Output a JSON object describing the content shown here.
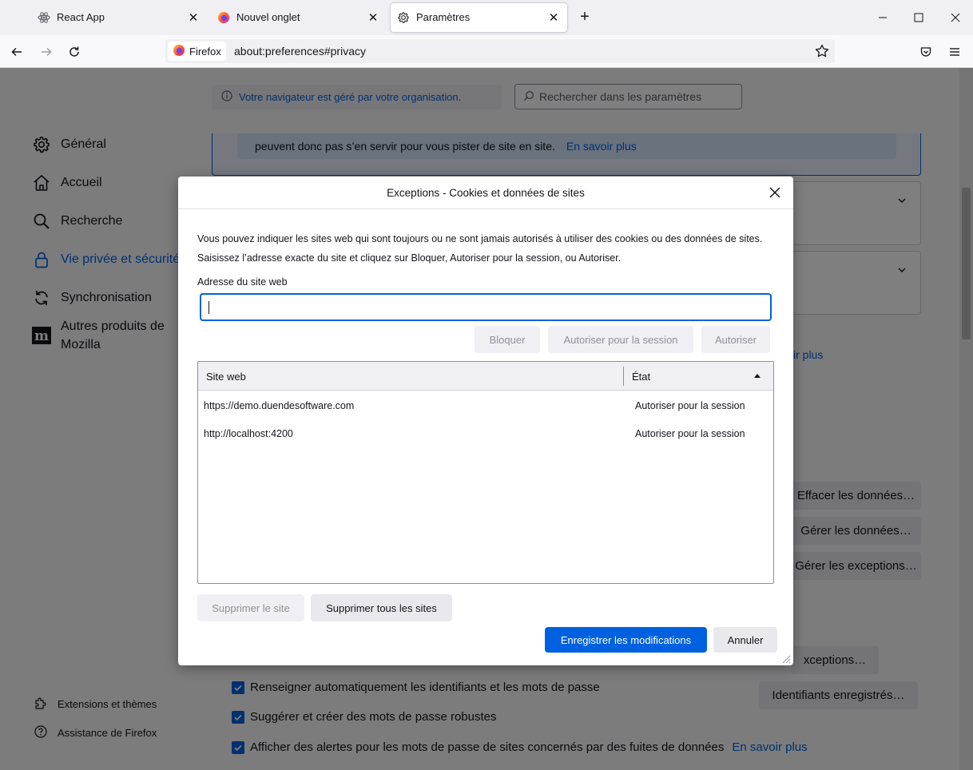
{
  "tabs": [
    {
      "label": "React App",
      "icon": "react-icon"
    },
    {
      "label": "Nouvel onglet",
      "icon": "firefox-icon"
    },
    {
      "label": "Paramètres",
      "icon": "gear-icon"
    }
  ],
  "navbar": {
    "identity_label": "Firefox",
    "url": "about:preferences#privacy"
  },
  "page": {
    "managed_notice": "Votre navigateur est géré par votre organisation.",
    "search_placeholder": "Rechercher dans les paramètres",
    "categories": [
      {
        "label": "Général",
        "icon": "gear-icon"
      },
      {
        "label": "Accueil",
        "icon": "home-icon"
      },
      {
        "label": "Recherche",
        "icon": "search-icon"
      },
      {
        "label": "Vie privée et sécurité",
        "icon": "lock-icon"
      },
      {
        "label": "Synchronisation",
        "icon": "sync-icon"
      },
      {
        "label": "Autres produits de Mozilla",
        "icon": "mozilla-icon"
      }
    ],
    "footer_links": [
      {
        "label": "Extensions et thèmes",
        "icon": "puzzle-icon"
      },
      {
        "label": "Assistance de Firefox",
        "icon": "help-icon"
      }
    ],
    "tracking_text": "peuvent donc pas s’en servir pour vous pister de site en site.",
    "learn_more": "En savoir plus",
    "partial_learn_more": "ir plus",
    "buttons": {
      "clear_data": "Effacer les données…",
      "manage_data": "Gérer les données…",
      "manage_exceptions": "Gérer les exceptions…",
      "exceptions": "xceptions…",
      "saved_logins": "Identifiants enregistrés…"
    },
    "checkboxes": [
      {
        "label": "Renseigner automatiquement les identifiants et les mots de passe",
        "link": ""
      },
      {
        "label": "Suggérer et créer des mots de passe robustes",
        "link": ""
      },
      {
        "label": "Afficher des alertes pour les mots de passe de sites concernés par des fuites de données",
        "link": "En savoir plus"
      }
    ]
  },
  "dialog": {
    "title": "Exceptions - Cookies et données de sites",
    "description": "Vous pouvez indiquer les sites web qui sont toujours ou ne sont jamais autorisés à utiliser des cookies ou des données de sites. Saisissez l’adresse exacte du site et cliquez sur Bloquer, Autoriser pour la session, ou Autoriser.",
    "address_label": "Adresse du site web",
    "address_value": "",
    "btn_block": "Bloquer",
    "btn_allow_session": "Autoriser pour la session",
    "btn_allow": "Autoriser",
    "col_site": "Site web",
    "col_status": "État",
    "rows": [
      {
        "site": "https://demo.duendesoftware.com",
        "status": "Autoriser pour la session"
      },
      {
        "site": "http://localhost:4200",
        "status": "Autoriser pour la session"
      }
    ],
    "btn_remove_site": "Supprimer le site",
    "btn_remove_all": "Supprimer tous les sites",
    "btn_save": "Enregistrer les modifications",
    "btn_cancel": "Annuler"
  },
  "colors": {
    "accent": "#0061e0",
    "overlay": "#7a7a7a"
  }
}
